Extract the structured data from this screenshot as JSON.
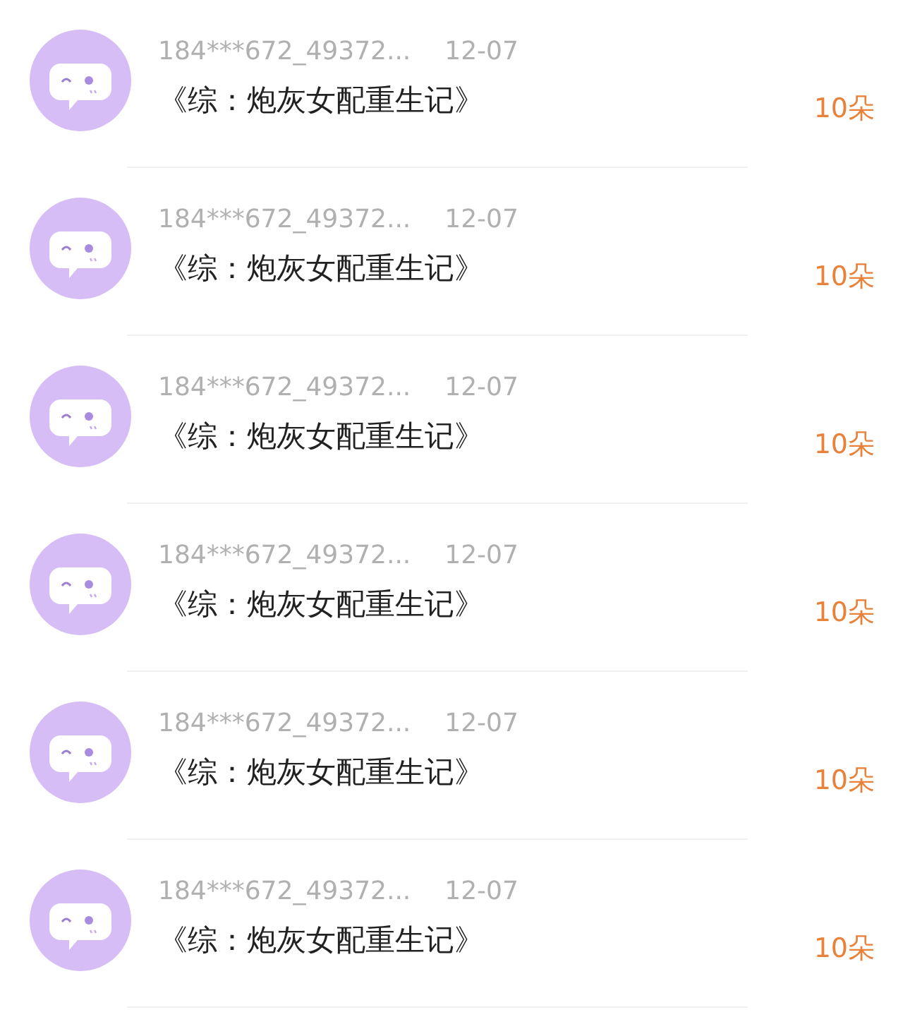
{
  "gifts": [
    {
      "user": "184***672_49372...",
      "date": "12-07",
      "book": "《综：炮灰女配重生记》",
      "amount": "10朵"
    },
    {
      "user": "184***672_49372...",
      "date": "12-07",
      "book": "《综：炮灰女配重生记》",
      "amount": "10朵"
    },
    {
      "user": "184***672_49372...",
      "date": "12-07",
      "book": "《综：炮灰女配重生记》",
      "amount": "10朵"
    },
    {
      "user": "184***672_49372...",
      "date": "12-07",
      "book": "《综：炮灰女配重生记》",
      "amount": "10朵"
    },
    {
      "user": "184***672_49372...",
      "date": "12-07",
      "book": "《综：炮灰女配重生记》",
      "amount": "10朵"
    },
    {
      "user": "184***672_49372...",
      "date": "12-07",
      "book": "《综：炮灰女配重生记》",
      "amount": "10朵"
    }
  ]
}
